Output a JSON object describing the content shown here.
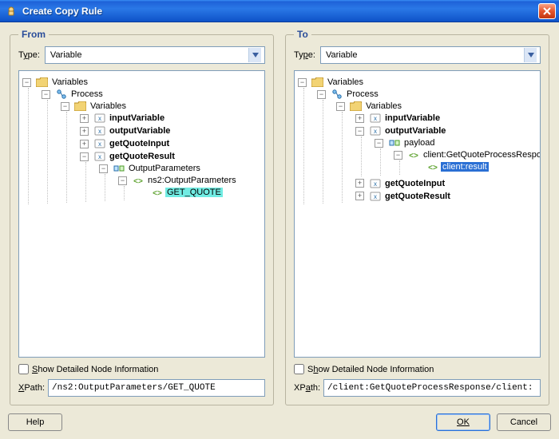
{
  "window": {
    "title": "Create Copy Rule"
  },
  "from": {
    "legend": "From",
    "type_label": "Type:",
    "type_value": "Variable",
    "detail_label": "Show Detailed Node Information",
    "xpath_label": "XPath:",
    "xpath_value": "/ns2:OutputParameters/GET_QUOTE",
    "tree": {
      "root": "Variables",
      "process": "Process",
      "variables": "Variables",
      "inputVariable": "inputVariable",
      "outputVariable": "outputVariable",
      "getQuoteInput": "getQuoteInput",
      "getQuoteResult": "getQuoteResult",
      "outputParameters": "OutputParameters",
      "ns2OutputParameters": "ns2:OutputParameters",
      "getQuote": "GET_QUOTE"
    }
  },
  "to": {
    "legend": "To",
    "type_label": "Type:",
    "type_value": "Variable",
    "detail_label": "Show Detailed Node Information",
    "xpath_label": "XPath:",
    "xpath_value": "/client:GetQuoteProcessResponse/client:",
    "tree": {
      "root": "Variables",
      "process": "Process",
      "variables": "Variables",
      "inputVariable": "inputVariable",
      "outputVariable": "outputVariable",
      "payload": "payload",
      "getQuoteProcessResponse": "client:GetQuoteProcessResponse",
      "clientResult": "client:result",
      "getQuoteInput": "getQuoteInput",
      "getQuoteResult": "getQuoteResult"
    }
  },
  "buttons": {
    "help": "Help",
    "ok": "OK",
    "cancel": "Cancel"
  }
}
